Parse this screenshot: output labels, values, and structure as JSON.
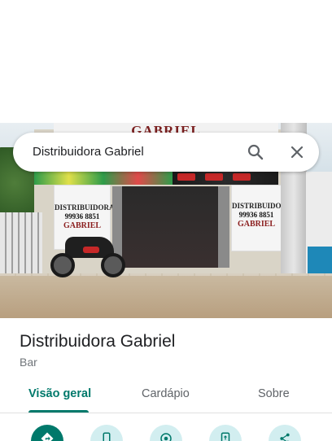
{
  "search": {
    "query": "Distribuidora Gabriel"
  },
  "photo": {
    "top_sign": "GABRIEL",
    "left_panel": [
      "DISTRIBUIDORA",
      "99936 8851",
      "GABRIEL"
    ],
    "right_panel": [
      "DISTRIBUIDOR",
      "99936 8851",
      "GABRIEL"
    ]
  },
  "place": {
    "name": "Distribuidora Gabriel",
    "category": "Bar"
  },
  "tabs": [
    {
      "label": "Visão geral",
      "active": true
    },
    {
      "label": "Cardápio",
      "active": false
    },
    {
      "label": "Sobre",
      "active": false
    }
  ],
  "actions": [
    {
      "icon": "directions-icon"
    },
    {
      "icon": "call-icon"
    },
    {
      "icon": "save-icon"
    },
    {
      "icon": "send-to-phone-icon"
    },
    {
      "icon": "share-icon"
    }
  ],
  "colors": {
    "accent": "#00796b",
    "action_bg": "#d2eef0"
  }
}
